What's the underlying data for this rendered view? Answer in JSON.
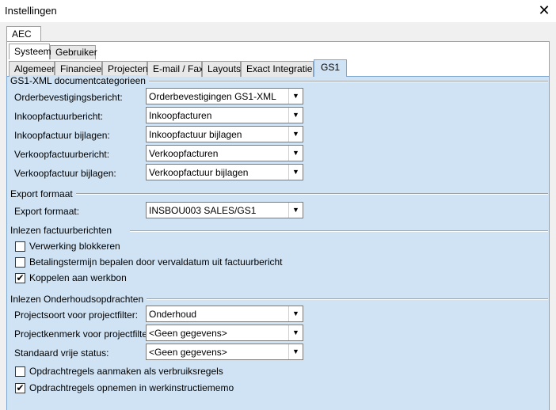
{
  "window": {
    "title": "Instellingen"
  },
  "tabs_top": [
    "AEC"
  ],
  "tabs_second": [
    "Systeem",
    "Gebruiker"
  ],
  "tabs_third": [
    "Algemeen",
    "Financieel",
    "Projecten",
    "E-mail / Fax",
    "Layouts",
    "Exact Integratie",
    "GS1"
  ],
  "groups": {
    "doccat": {
      "title": "GS1-XML documentcategorieen",
      "rows": [
        {
          "label": "Orderbevestigingsbericht:",
          "value": "Orderbevestigingen GS1-XML"
        },
        {
          "label": "Inkoopfactuurbericht:",
          "value": "Inkoopfacturen"
        },
        {
          "label": "Inkoopfactuur bijlagen:",
          "value": "Inkoopfactuur bijlagen"
        },
        {
          "label": "Verkoopfactuurbericht:",
          "value": "Verkoopfacturen"
        },
        {
          "label": "Verkoopfactuur bijlagen:",
          "value": "Verkoopfactuur bijlagen"
        }
      ]
    },
    "export": {
      "title": "Export formaat",
      "rows": [
        {
          "label": "Export formaat:",
          "value": "INSBOU003 SALES/GS1"
        }
      ]
    },
    "inlezen_factuur": {
      "title": "Inlezen factuurberichten",
      "checks": [
        {
          "label": "Verwerking blokkeren",
          "checked": false
        },
        {
          "label": "Betalingstermijn bepalen door vervaldatum uit factuurbericht",
          "checked": false
        },
        {
          "label": "Koppelen aan werkbon",
          "checked": true
        }
      ]
    },
    "inlezen_onderhoud": {
      "title": "Inlezen Onderhoudsopdrachten",
      "rows": [
        {
          "label": "Projectsoort voor projectfilter:",
          "value": "Onderhoud"
        },
        {
          "label": "Projectkenmerk voor projectfilter:",
          "value": "<Geen gegevens>"
        },
        {
          "label": "Standaard vrije status:",
          "value": "<Geen gegevens>"
        }
      ],
      "checks": [
        {
          "label": "Opdrachtregels aanmaken als verbruiksregels",
          "checked": false
        },
        {
          "label": "Opdrachtregels opnemen in werkinstructiememo",
          "checked": true
        }
      ]
    }
  },
  "icons": {
    "close": "close-icon",
    "dropdown": "chevron-down-icon",
    "check": "checkmark-icon"
  },
  "glyphs": {
    "close": "✕",
    "arrow": "▼",
    "check": "✔"
  }
}
